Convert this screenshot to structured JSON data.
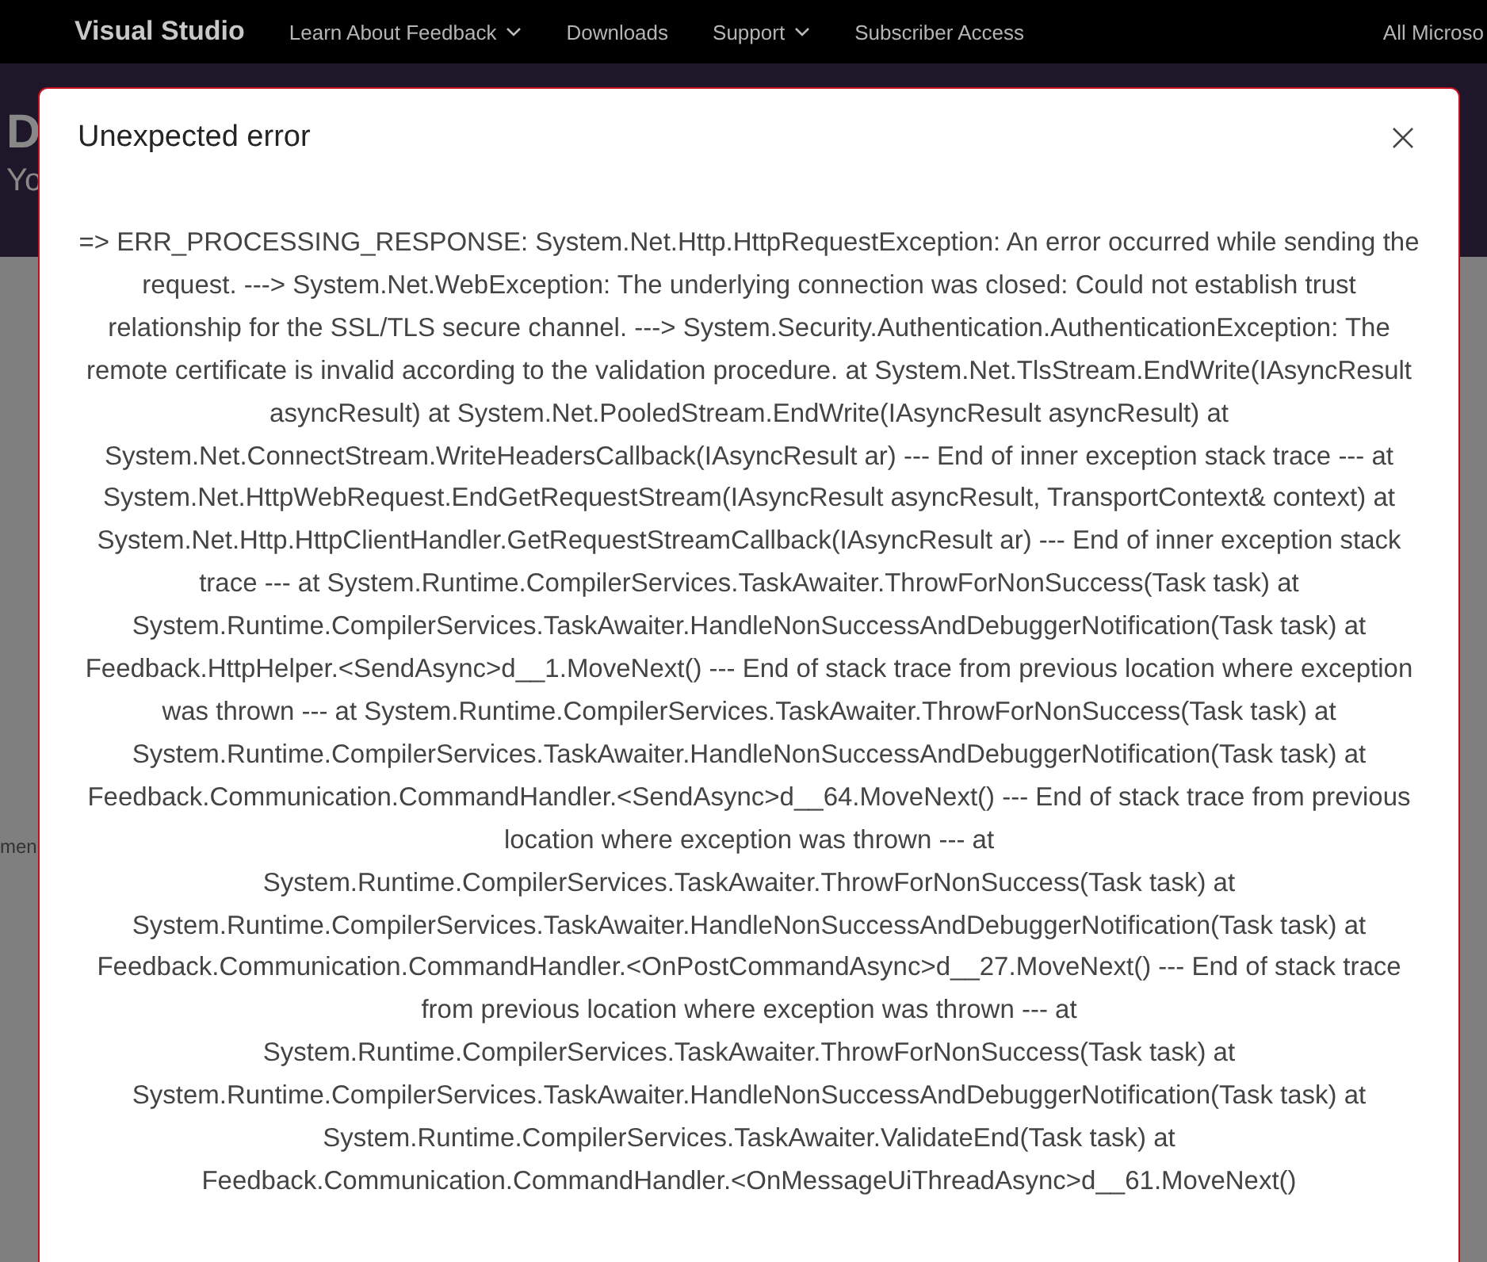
{
  "nav": {
    "brand": "Visual Studio",
    "items": [
      {
        "label": "Learn About Feedback",
        "kind": "dropdown"
      },
      {
        "label": "Downloads",
        "kind": "link"
      },
      {
        "label": "Support",
        "kind": "dropdown"
      },
      {
        "label": "Subscriber Access",
        "kind": "link"
      }
    ],
    "right_link": "All Microso"
  },
  "page_behind": {
    "heading": "D",
    "subheading": "Yo",
    "side_text": "men"
  },
  "dialog": {
    "title": "Unexpected error",
    "message": "=> ERR_PROCESSING_RESPONSE: System.Net.Http.HttpRequestException: An error occurred while sending the request. ---> System.Net.WebException: The underlying connection was closed: Could not establish trust relationship for the SSL/TLS secure channel. ---> System.Security.Authentication.AuthenticationException: The remote certificate is invalid according to the validation procedure. at System.Net.TlsStream.EndWrite(IAsyncResult asyncResult) at System.Net.PooledStream.EndWrite(IAsyncResult asyncResult) at System.Net.ConnectStream.WriteHeadersCallback(IAsyncResult ar) --- End of inner exception stack trace --- at System.Net.HttpWebRequest.EndGetRequestStream(IAsyncResult asyncResult, TransportContext& context) at System.Net.Http.HttpClientHandler.GetRequestStreamCallback(IAsyncResult ar) --- End of inner exception stack trace --- at System.Runtime.CompilerServices.TaskAwaiter.ThrowForNonSuccess(Task task) at System.Runtime.CompilerServices.TaskAwaiter.HandleNonSuccessAndDebuggerNotification(Task task) at Feedback.HttpHelper.<SendAsync>d__1.MoveNext() --- End of stack trace from previous location where exception was thrown --- at System.Runtime.CompilerServices.TaskAwaiter.ThrowForNonSuccess(Task task) at System.Runtime.CompilerServices.TaskAwaiter.HandleNonSuccessAndDebuggerNotification(Task task) at Feedback.Communication.CommandHandler.<SendAsync>d__64.MoveNext() --- End of stack trace from previous location where exception was thrown --- at System.Runtime.CompilerServices.TaskAwaiter.ThrowForNonSuccess(Task task) at System.Runtime.CompilerServices.TaskAwaiter.HandleNonSuccessAndDebuggerNotification(Task task) at Feedback.Communication.CommandHandler.<OnPostCommandAsync>d__27.MoveNext() --- End of stack trace from previous location where exception was thrown --- at System.Runtime.CompilerServices.TaskAwaiter.ThrowForNonSuccess(Task task) at System.Runtime.CompilerServices.TaskAwaiter.HandleNonSuccessAndDebuggerNotification(Task task) at System.Runtime.CompilerServices.TaskAwaiter.ValidateEnd(Task task) at Feedback.Communication.CommandHandler.<OnMessageUiThreadAsync>d__61.MoveNext()"
  }
}
